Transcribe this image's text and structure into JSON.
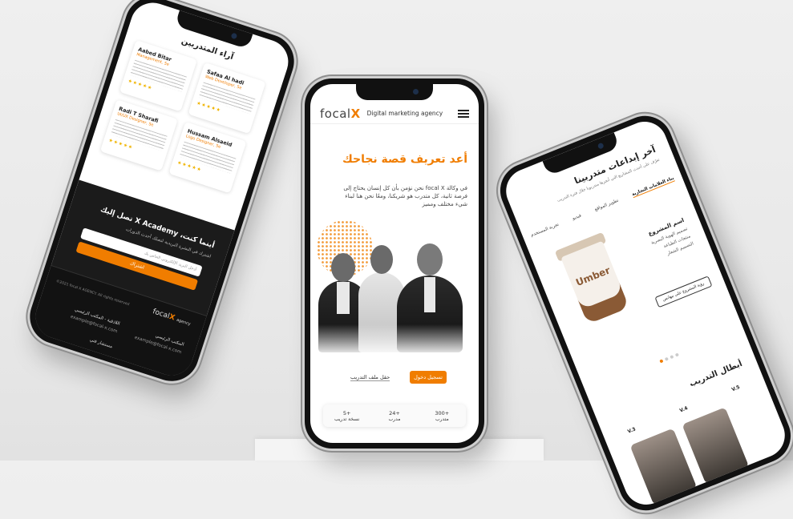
{
  "colors": {
    "accent": "#f07d00"
  },
  "center": {
    "logo_main": "focal",
    "logo_x": "X",
    "tagline": "Digital marketing agency",
    "hero_title": "أعد تعريف قصة نجاحك",
    "hero_text": "في وكالة focal X نحن نؤمن بأن كل إنسان يحتاج إلى فرصة ثانية، كل متدرب هو شريكنا، ومعًا نحن هنا لبناء شيء مختلف ومميز",
    "btn_register": "تسجيل دخول",
    "btn_profile": "حقل ملف التدريب",
    "stats": [
      {
        "n": "300+",
        "l": "متدرب"
      },
      {
        "n": "24+",
        "l": "مدرب"
      },
      {
        "n": "5+",
        "l": "نسخة تدريب"
      }
    ]
  },
  "left": {
    "testimonials_title": "آراء المتدربين",
    "cards": [
      {
        "name": "Aabed Bitar",
        "role": "Management, 5e",
        "stars": "★★★★★"
      },
      {
        "name": "Safaa Al hadi",
        "role": "Web Developer, 5e",
        "stars": "★★★★★"
      },
      {
        "name": "Radi T Sharafi",
        "role": "UI/UX Designer, 5e",
        "stars": "★★★★★"
      },
      {
        "name": "Hussam Alsaeid",
        "role": "Logo Designer, 5e",
        "stars": "★★★★★"
      }
    ],
    "subscribe_title": "أينما كنت، X Academy تصل إليك",
    "subscribe_sub": "اشترك في النشرة البريدية لتصلك أحدث الدورات",
    "email_placeholder": "أدخل البريد الإلكتروني الخاص بك",
    "subscribe_btn": "اشتراك",
    "footer_logo": "focal",
    "footer_logo_x": "X",
    "footer_logo_suffix": "agency",
    "office1_title": "المكتب الرئيسي",
    "office1_email": "example@focal-x.com",
    "office2_title": "اللاذقية - المكتب الرئيسي",
    "office2_email": "example@focal-x.com",
    "office3_title": "مستشار فني",
    "copyright": "©2021 focal X AGENCY. All rights reserved"
  },
  "right": {
    "latest_title": "آخر إبداعات متدربينا",
    "latest_sub": "تعرّف على أحدث المشاريع التي أنجزها متدربونا خلال فترة التدريب",
    "tabs": [
      {
        "label": "بناء العلامات التجارية",
        "active": true
      },
      {
        "label": "تطوير المواقع",
        "active": false
      },
      {
        "label": "فيديو",
        "active": false
      },
      {
        "label": "تجربة المستخدم",
        "active": false
      }
    ],
    "cup_brand": "Umber",
    "project_name": "اسم المشروع",
    "project_items": [
      "تصميم الهوية البصرية",
      "منتجات الطباعة",
      "التصميم الشعار"
    ],
    "project_btn": "رؤية المشروع على بيهانس",
    "heroes_title": "أبطال التدريب",
    "versions": [
      "V.5",
      "V.4",
      "V.3"
    ]
  }
}
